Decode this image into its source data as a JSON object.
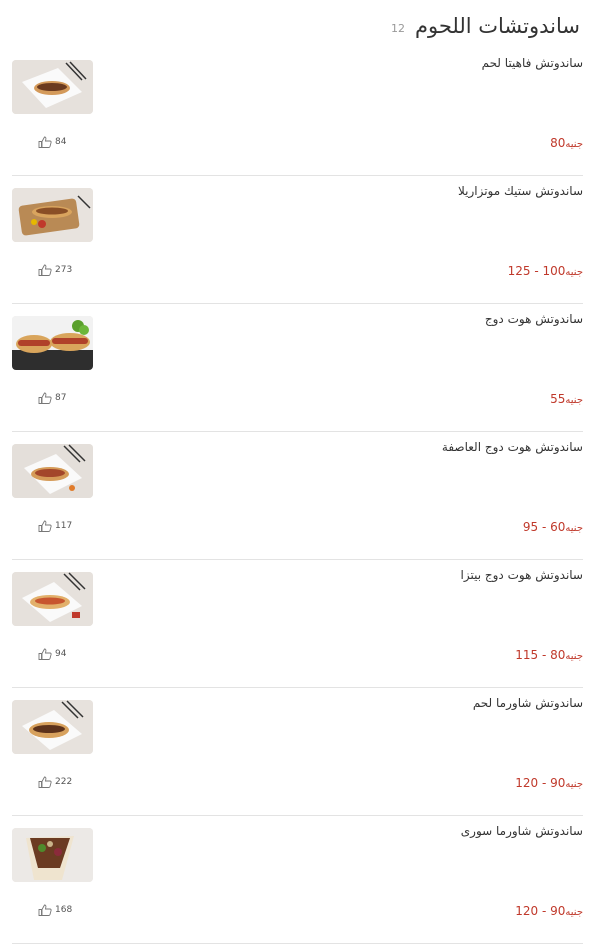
{
  "section": {
    "title": "ساندوتشات اللحوم",
    "count": "12"
  },
  "currency": "جنيه",
  "colors": {
    "price": "#c0392b",
    "text": "#333333",
    "divider": "#e3e3e3"
  },
  "items": [
    {
      "name": "ساندوتش فاهيتا لحم",
      "price": "80",
      "likes": "84",
      "image_icon": "fajita-sandwich-photo"
    },
    {
      "name": "ساندوتش ستيك موتزاريلا",
      "price": "100 - 125",
      "likes": "273",
      "image_icon": "steak-mozzarella-photo"
    },
    {
      "name": "ساندوتش هوت دوج",
      "price": "55",
      "likes": "87",
      "image_icon": "hotdog-photo"
    },
    {
      "name": "ساندوتش هوت دوج العاصفة",
      "price": "60 - 95",
      "likes": "117",
      "image_icon": "storm-hotdog-photo"
    },
    {
      "name": "ساندوتش هوت دوج بيتزا",
      "price": "80 - 115",
      "likes": "94",
      "image_icon": "pizza-hotdog-photo"
    },
    {
      "name": "ساندوتش شاورما لحم",
      "price": "90 - 120",
      "likes": "222",
      "image_icon": "beef-shawarma-photo"
    },
    {
      "name": "ساندوتش شاورما سورى",
      "price": "90 - 120",
      "likes": "168",
      "image_icon": "syrian-shawarma-photo"
    }
  ]
}
